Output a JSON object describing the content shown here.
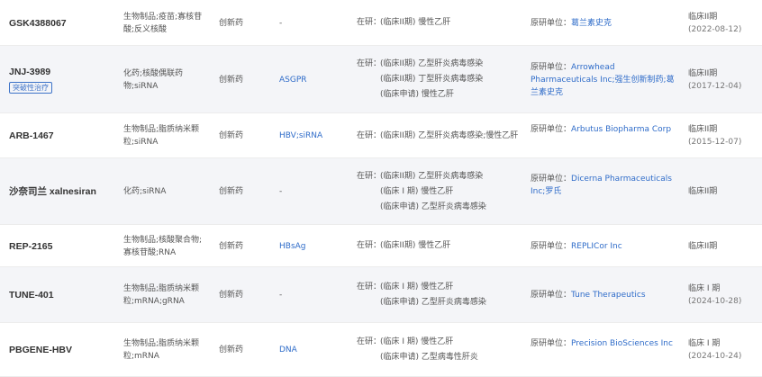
{
  "columns_note_hidden": false,
  "rows": [
    {
      "name": "GSK4388067",
      "badge": "",
      "type": "生物制品;疫苗;寡核苷酸;反义核酸",
      "category": "创新药",
      "target": "-",
      "stages": [
        {
          "prefix": "在研：",
          "text": "(临床II期) 慢性乙肝"
        }
      ],
      "inst_label": "原研单位：",
      "inst_value": "葛兰素史克",
      "phase": "临床II期",
      "date": "(2022-08-12)"
    },
    {
      "name": "JNJ-3989",
      "badge": "突破性治疗",
      "type": "化药;核酸偶联药物;siRNA",
      "category": "创新药",
      "target": "ASGPR",
      "stages": [
        {
          "prefix": "在研：",
          "text": "(临床II期) 乙型肝炎病毒感染"
        },
        {
          "prefix": "",
          "text": "(临床II期) 丁型肝炎病毒感染"
        },
        {
          "prefix": "",
          "text": "(临床申请) 慢性乙肝"
        }
      ],
      "inst_label": "原研单位：",
      "inst_value": "Arrowhead Pharmaceuticals Inc;强生创新制药;葛兰素史克",
      "phase": "临床II期",
      "date": "(2017-12-04)"
    },
    {
      "name": "ARB-1467",
      "badge": "",
      "type": "生物制品;脂质纳米颗粒;siRNA",
      "category": "创新药",
      "target": "HBV;siRNA",
      "stages": [
        {
          "prefix": "在研：",
          "text": "(临床II期) 乙型肝炎病毒感染;慢性乙肝"
        }
      ],
      "inst_label": "原研单位：",
      "inst_value": "Arbutus Biopharma Corp",
      "phase": "临床II期",
      "date": "(2015-12-07)"
    },
    {
      "name": "沙奈司兰 xalnesiran",
      "badge": "",
      "type": "化药;siRNA",
      "category": "创新药",
      "target": "-",
      "stages": [
        {
          "prefix": "在研：",
          "text": "(临床II期) 乙型肝炎病毒感染"
        },
        {
          "prefix": "",
          "text": "(临床 I 期) 慢性乙肝"
        },
        {
          "prefix": "",
          "text": "(临床申请) 乙型肝炎病毒感染"
        }
      ],
      "inst_label": "原研单位：",
      "inst_value": "Dicerna Pharmaceuticals Inc;罗氏",
      "phase": "临床II期",
      "date": ""
    },
    {
      "name": "REP-2165",
      "badge": "",
      "type": "生物制品;核酸聚合物;寡核苷酸;RNA",
      "category": "创新药",
      "target": "HBsAg",
      "stages": [
        {
          "prefix": "在研：",
          "text": "(临床II期) 慢性乙肝"
        }
      ],
      "inst_label": "原研单位：",
      "inst_value": "REPLICor Inc",
      "phase": "临床II期",
      "date": ""
    },
    {
      "name": "TUNE-401",
      "badge": "",
      "type": "生物制品;脂质纳米颗粒;mRNA;gRNA",
      "category": "创新药",
      "target": "-",
      "stages": [
        {
          "prefix": "在研：",
          "text": "(临床 I 期) 慢性乙肝"
        },
        {
          "prefix": "",
          "text": "(临床申请) 乙型肝炎病毒感染"
        }
      ],
      "inst_label": "原研单位：",
      "inst_value": "Tune Therapeutics",
      "phase": "临床 I 期",
      "date": "(2024-10-28)"
    },
    {
      "name": "PBGENE-HBV",
      "badge": "",
      "type": "生物制品;脂质纳米颗粒;mRNA",
      "category": "创新药",
      "target": "DNA",
      "stages": [
        {
          "prefix": "在研：",
          "text": "(临床 I 期) 慢性乙肝"
        },
        {
          "prefix": "",
          "text": "(临床申请) 乙型病毒性肝炎"
        }
      ],
      "inst_label": "原研单位：",
      "inst_value": "Precision BioSciences Inc",
      "phase": "临床 I 期",
      "date": "(2024-10-24)"
    }
  ]
}
